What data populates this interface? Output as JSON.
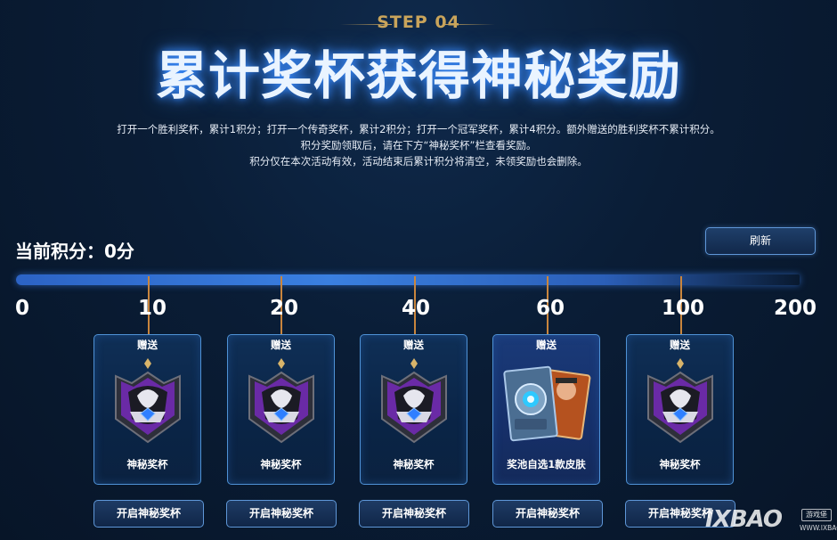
{
  "header": {
    "step": "STEP 04",
    "title": "累计奖杯获得神秘奖励",
    "description": [
      "打开一个胜利奖杯，累计1积分；打开一个传奇奖杯，累计2积分；打开一个冠军奖杯，累计4积分。额外赠送的胜利奖杯不累计积分。",
      "积分奖励领取后，请在下方“神秘奖杯”栏查看奖励。",
      "积分仅在本次活动有效，活动结束后累计积分将清空，未领奖励也会删除。"
    ]
  },
  "score": {
    "label": "当前积分：0分",
    "value": 0
  },
  "refresh_label": "刷新",
  "progress": {
    "labels": [
      "0",
      "10",
      "20",
      "40",
      "60",
      "100",
      "200"
    ],
    "fraction": 0
  },
  "rewards": [
    {
      "points": "10",
      "tag": "赠送",
      "name": "神秘奖杯",
      "icon": "mystery-trophy-icon",
      "button": "开启神秘奖杯"
    },
    {
      "points": "20",
      "tag": "赠送",
      "name": "神秘奖杯",
      "icon": "mystery-trophy-icon",
      "button": "开启神秘奖杯"
    },
    {
      "points": "40",
      "tag": "赠送",
      "name": "神秘奖杯",
      "icon": "mystery-trophy-icon",
      "button": "开启神秘奖杯"
    },
    {
      "points": "60",
      "tag": "赠送",
      "name": "奖池自选1款皮肤",
      "icon": "skin-pool-icon",
      "button": "开启神秘奖杯"
    },
    {
      "points": "100",
      "tag": "赠送",
      "name": "神秘奖杯",
      "icon": "mystery-trophy-icon",
      "button": "开启神秘奖杯"
    }
  ],
  "watermark": {
    "brand": "IXBAO",
    "sub": "游戏堡",
    "url": "WWW.IXBAO.COM"
  },
  "colors": {
    "accent_gold": "#c9a45b",
    "bar_blue": "#3a7fe0",
    "card_border": "#4f92d6",
    "tick": "#c9853d"
  }
}
